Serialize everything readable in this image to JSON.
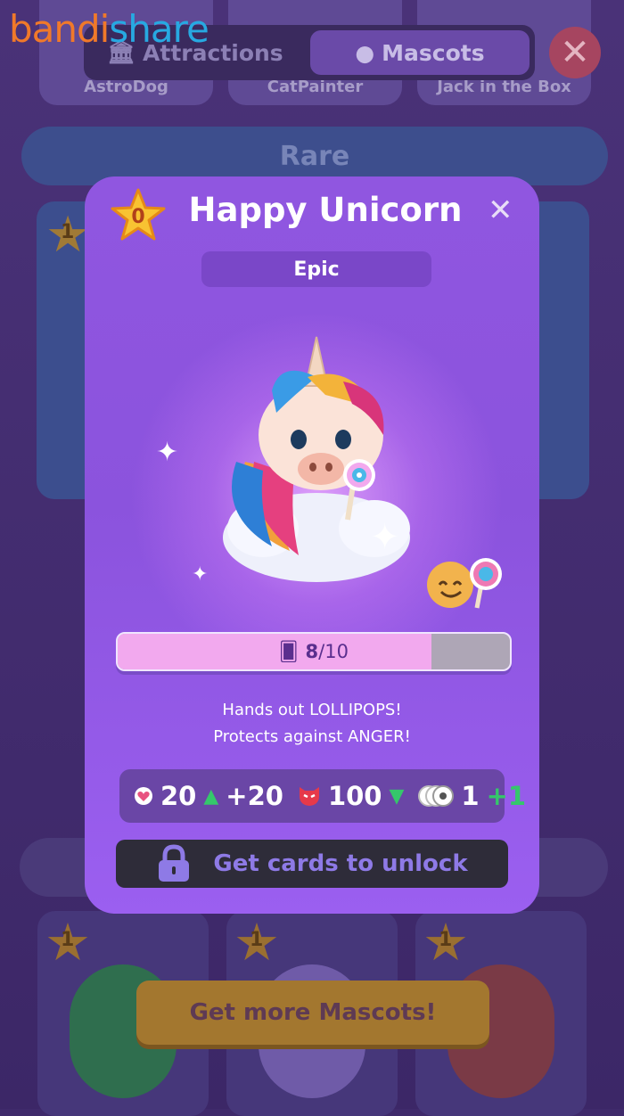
{
  "watermark": {
    "part1": "bandi",
    "part2": "share"
  },
  "background": {
    "top_cards": [
      "AstroDog",
      "CatPainter",
      "Jack in the Box"
    ],
    "tabs": {
      "attractions": "Attractions",
      "mascots": "Mascots"
    },
    "section_rare": "Rare",
    "mid_cards": [
      {
        "level": "1"
      },
      {
        "level": ""
      },
      {
        "level": ""
      }
    ],
    "bottom_cards": [
      {
        "level": "1"
      },
      {
        "level": "1"
      },
      {
        "level": "1"
      }
    ],
    "get_more_label": "Get more Mascots!"
  },
  "modal": {
    "level": "0",
    "title": "Happy Unicorn",
    "close": "✕",
    "rarity": "Epic",
    "progress": {
      "current": "8",
      "total": "/10",
      "fraction": 0.8
    },
    "description_line1": "Hands out LOLLIPOPS!",
    "description_line2": "Protects against ANGER!",
    "stats": {
      "hearts": "20",
      "hearts_bonus": "+20",
      "anger": "100",
      "guests": "1",
      "guests_bonus": "+1"
    },
    "unlock_label": "Get cards to unlock"
  },
  "colors": {
    "modal_bg": "#8b53dd",
    "accent_green": "#35c76b",
    "progress_fill": "#f2a9ee"
  }
}
